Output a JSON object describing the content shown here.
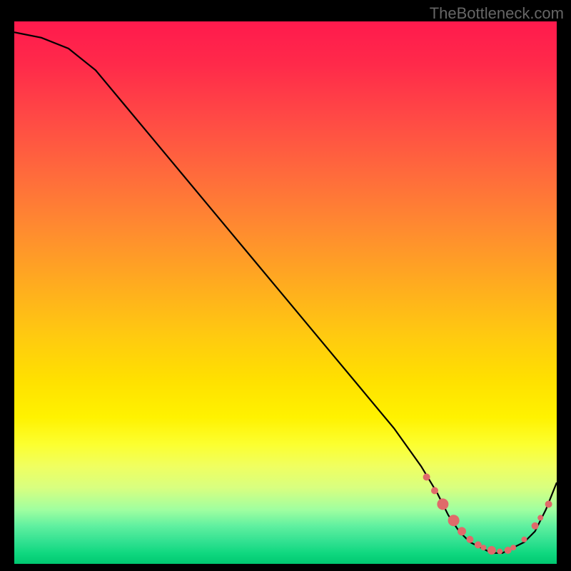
{
  "watermark": "TheBottleneck.com",
  "chart_data": {
    "type": "line",
    "title": "",
    "xlabel": "",
    "ylabel": "",
    "xlim": [
      0,
      100
    ],
    "ylim": [
      0,
      100
    ],
    "grid": false,
    "series": [
      {
        "name": "curve",
        "color": "#000000",
        "x": [
          0,
          5,
          10,
          15,
          20,
          25,
          30,
          35,
          40,
          45,
          50,
          55,
          60,
          65,
          70,
          75,
          78,
          80,
          82,
          84,
          86,
          88,
          90,
          92,
          94,
          96,
          98,
          100
        ],
        "y": [
          98,
          97,
          95,
          91,
          85,
          79,
          73,
          67,
          61,
          55,
          49,
          43,
          37,
          31,
          25,
          18,
          13,
          9,
          6,
          4,
          3,
          2,
          2,
          3,
          4,
          6,
          10,
          15
        ]
      }
    ],
    "markers": [
      {
        "x": 76,
        "y": 16,
        "r": 5,
        "color": "#e06a6a"
      },
      {
        "x": 77.5,
        "y": 13.5,
        "r": 5,
        "color": "#e06a6a"
      },
      {
        "x": 79,
        "y": 11,
        "r": 8,
        "color": "#e06a6a"
      },
      {
        "x": 81,
        "y": 8,
        "r": 8,
        "color": "#e06a6a"
      },
      {
        "x": 82.5,
        "y": 6,
        "r": 6,
        "color": "#e06a6a"
      },
      {
        "x": 84,
        "y": 4.5,
        "r": 5,
        "color": "#e06a6a"
      },
      {
        "x": 85.5,
        "y": 3.5,
        "r": 5,
        "color": "#e06a6a"
      },
      {
        "x": 86.5,
        "y": 3,
        "r": 4,
        "color": "#e06a6a"
      },
      {
        "x": 88,
        "y": 2.5,
        "r": 6,
        "color": "#e06a6a"
      },
      {
        "x": 89.5,
        "y": 2.3,
        "r": 4,
        "color": "#e06a6a"
      },
      {
        "x": 91,
        "y": 2.5,
        "r": 5,
        "color": "#e06a6a"
      },
      {
        "x": 92,
        "y": 3,
        "r": 4,
        "color": "#e06a6a"
      },
      {
        "x": 94,
        "y": 4.5,
        "r": 4,
        "color": "#e06a6a"
      },
      {
        "x": 96,
        "y": 7,
        "r": 5,
        "color": "#e06a6a"
      },
      {
        "x": 97,
        "y": 8.5,
        "r": 4,
        "color": "#e06a6a"
      },
      {
        "x": 98.5,
        "y": 11,
        "r": 5,
        "color": "#e06a6a"
      }
    ],
    "background_gradient": {
      "direction": "vertical",
      "stops": [
        {
          "pos": 0,
          "color": "#ff1a4d"
        },
        {
          "pos": 50,
          "color": "#ffcc00"
        },
        {
          "pos": 80,
          "color": "#fff200"
        },
        {
          "pos": 100,
          "color": "#00c870"
        }
      ]
    }
  }
}
